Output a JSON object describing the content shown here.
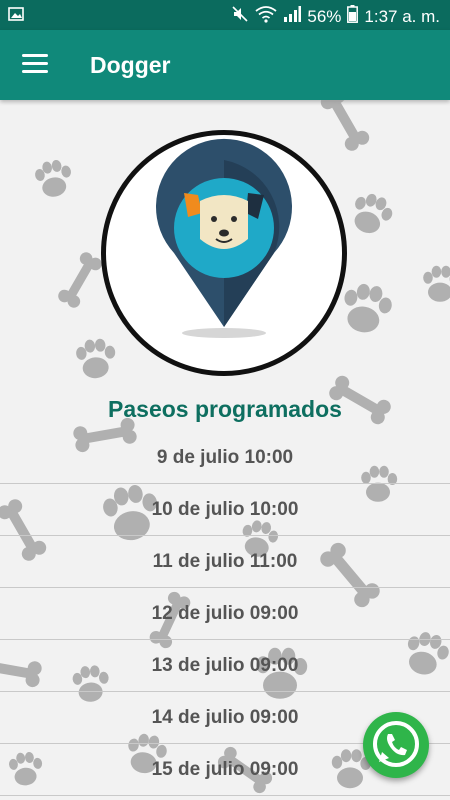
{
  "status_bar": {
    "battery": "56%",
    "time": "1:37 a. m.",
    "icons": [
      "image-icon",
      "mute-icon",
      "wifi-icon",
      "signal-icon",
      "battery-icon"
    ]
  },
  "app_bar": {
    "title": "Dogger",
    "menu_icon": "menu-icon",
    "color": "#10897a"
  },
  "logo": {
    "icon": "dog-location-pin-logo"
  },
  "section_title": "Paseos programados",
  "walks": [
    "9 de julio 10:00",
    "10 de julio 10:00",
    "11 de julio 11:00",
    "12 de julio 09:00",
    "13 de julio 09:00",
    "14 de julio 09:00",
    "15 de julio 09:00"
  ],
  "fab": {
    "icon": "whatsapp-icon",
    "color": "#2fb54a"
  }
}
